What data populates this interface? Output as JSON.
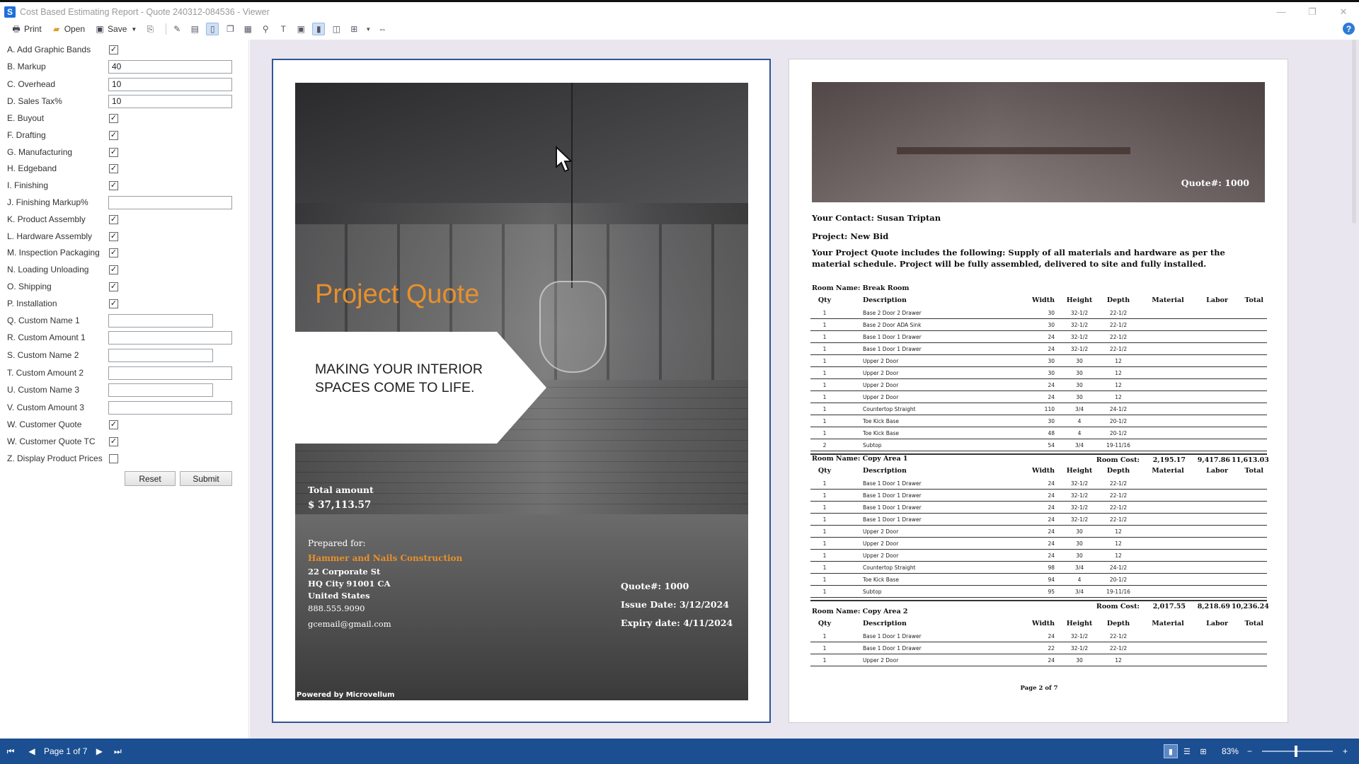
{
  "window": {
    "title": "Cost Based Estimating Report - Quote 240312-084536 - Viewer",
    "controls": [
      "—",
      "❐",
      "✕"
    ]
  },
  "toolbar": {
    "print_label": "Print",
    "open_label": "Open",
    "save_label": "Save"
  },
  "params": {
    "add_graphic_bands": {
      "label": "A. Add Graphic Bands",
      "checked": true
    },
    "markup": {
      "label": "B. Markup",
      "value": "40"
    },
    "overhead": {
      "label": "C. Overhead",
      "value": "10"
    },
    "sales_tax": {
      "label": "D. Sales Tax%",
      "value": "10"
    },
    "buyout": {
      "label": "E. Buyout",
      "checked": true
    },
    "drafting": {
      "label": "F. Drafting",
      "checked": true
    },
    "manufacturing": {
      "label": "G. Manufacturing",
      "checked": true
    },
    "edgeband": {
      "label": "H. Edgeband",
      "checked": true
    },
    "finishing": {
      "label": "I. Finishing",
      "checked": true
    },
    "finishing_markup": {
      "label": "J. Finishing Markup%",
      "value": ""
    },
    "product_assembly": {
      "label": "K. Product Assembly",
      "checked": true
    },
    "hardware_assembly": {
      "label": "L. Hardware Assembly",
      "checked": true
    },
    "inspection_packaging": {
      "label": "M. Inspection  Packaging",
      "checked": true
    },
    "loading_unloading": {
      "label": "N. Loading  Unloading",
      "checked": true
    },
    "shipping": {
      "label": "O. Shipping",
      "checked": true
    },
    "installation": {
      "label": "P. Installation",
      "checked": true
    },
    "custom_name_1": {
      "label": "Q. Custom Name 1",
      "value": ""
    },
    "custom_amount_1": {
      "label": "R. Custom Amount 1",
      "value": ""
    },
    "custom_name_2": {
      "label": "S. Custom Name 2",
      "value": ""
    },
    "custom_amount_2": {
      "label": "T. Custom Amount 2",
      "value": ""
    },
    "custom_name_3": {
      "label": "U. Custom Name 3",
      "value": ""
    },
    "custom_amount_3": {
      "label": "V. Custom Amount 3",
      "value": ""
    },
    "customer_quote": {
      "label": "W. Customer Quote",
      "checked": true
    },
    "customer_quote_tc": {
      "label": "W. Customer Quote TC",
      "checked": true
    },
    "display_product_prices": {
      "label": "Z. Display Product Prices",
      "checked": false
    },
    "reset_label": "Reset",
    "submit_label": "Submit"
  },
  "cover": {
    "title": "Project Quote",
    "tagline": "MAKING YOUR INTERIOR SPACES COME TO LIFE.",
    "total_label": "Total amount",
    "total_value": "$  37,113.57",
    "prepared_for": "Prepared for:",
    "company": "Hammer and Nails Construction",
    "street": "22 Corporate St",
    "city": "HQ City  91001    CA",
    "country": "United States",
    "phone": "888.555.9090",
    "email": "gcemail@gmail.com",
    "quote_no": "Quote#: 1000",
    "issue_date": "Issue Date: 3/12/2024",
    "expiry_date": "Expiry date: 4/11/2024",
    "powered_by": "Powered by Microvellum"
  },
  "page2": {
    "quote_no": "Quote#: 1000",
    "contact": "Your Contact: Susan Triptan",
    "project": "Project: New Bid",
    "paragraph": "Your Project Quote includes the following: Supply of all materials and hardware as per the material schedule. Project will be fully assembled, delivered to site and fully installed.",
    "columns": {
      "qty": "Qty",
      "desc": "Description",
      "width": "Width",
      "height": "Height",
      "depth": "Depth",
      "material": "Material",
      "labor": "Labor",
      "total": "Total"
    },
    "room_cost_label": "Room Cost:",
    "rooms": [
      {
        "name": "Room Name: Break Room",
        "rows": [
          [
            "1",
            "Base 2 Door 2 Drawer",
            "30",
            "32-1/2",
            "22-1/2"
          ],
          [
            "1",
            "Base 2 Door ADA Sink",
            "30",
            "32-1/2",
            "22-1/2"
          ],
          [
            "1",
            "Base 1 Door 1 Drawer",
            "24",
            "32-1/2",
            "22-1/2"
          ],
          [
            "1",
            "Base 1 Door 1 Drawer",
            "24",
            "32-1/2",
            "22-1/2"
          ],
          [
            "1",
            "Upper 2 Door",
            "30",
            "30",
            "12"
          ],
          [
            "1",
            "Upper 2 Door",
            "30",
            "30",
            "12"
          ],
          [
            "1",
            "Upper 2 Door",
            "24",
            "30",
            "12"
          ],
          [
            "1",
            "Upper 2 Door",
            "24",
            "30",
            "12"
          ],
          [
            "1",
            "Countertop Straight",
            "110",
            "3/4",
            "24-1/2"
          ],
          [
            "1",
            "Toe Kick Base",
            "30",
            "4",
            "20-1/2"
          ],
          [
            "1",
            "Toe Kick Base",
            "48",
            "4",
            "20-1/2"
          ],
          [
            "2",
            "Subtop",
            "54",
            "3/4",
            "19-11/16"
          ]
        ],
        "cost": {
          "material": "2,195.17",
          "labor": "9,417.86",
          "total": "11,613.03"
        }
      },
      {
        "name": "Room Name: Copy Area 1",
        "rows": [
          [
            "1",
            "Base 1 Door 1 Drawer",
            "24",
            "32-1/2",
            "22-1/2"
          ],
          [
            "1",
            "Base 1 Door 1 Drawer",
            "24",
            "32-1/2",
            "22-1/2"
          ],
          [
            "1",
            "Base 1 Door 1 Drawer",
            "24",
            "32-1/2",
            "22-1/2"
          ],
          [
            "1",
            "Base 1 Door 1 Drawer",
            "24",
            "32-1/2",
            "22-1/2"
          ],
          [
            "1",
            "Upper 2 Door",
            "24",
            "30",
            "12"
          ],
          [
            "1",
            "Upper 2 Door",
            "24",
            "30",
            "12"
          ],
          [
            "1",
            "Upper 2 Door",
            "24",
            "30",
            "12"
          ],
          [
            "1",
            "Countertop Straight",
            "98",
            "3/4",
            "24-1/2"
          ],
          [
            "1",
            "Toe Kick Base",
            "94",
            "4",
            "20-1/2"
          ],
          [
            "1",
            "Subtop",
            "95",
            "3/4",
            "19-11/16"
          ]
        ],
        "cost": {
          "material": "2,017.55",
          "labor": "8,218.69",
          "total": "10,236.24"
        }
      },
      {
        "name": "Room Name: Copy Area 2",
        "rows": [
          [
            "1",
            "Base 1 Door 1 Drawer",
            "24",
            "32-1/2",
            "22-1/2"
          ],
          [
            "1",
            "Base 1 Door 1 Drawer",
            "22",
            "32-1/2",
            "22-1/2"
          ],
          [
            "1",
            "Upper 2 Door",
            "24",
            "30",
            "12"
          ]
        ],
        "cost": null
      }
    ],
    "footer": "Page 2 of 7"
  },
  "statusbar": {
    "page_label": "Page 1 of 7",
    "zoom": "83%",
    "zoom_minus": "−",
    "zoom_plus": "+"
  },
  "colors": {
    "accent": "#e8902a",
    "statusbar": "#1b4f91",
    "page_border": "#2f5597"
  }
}
